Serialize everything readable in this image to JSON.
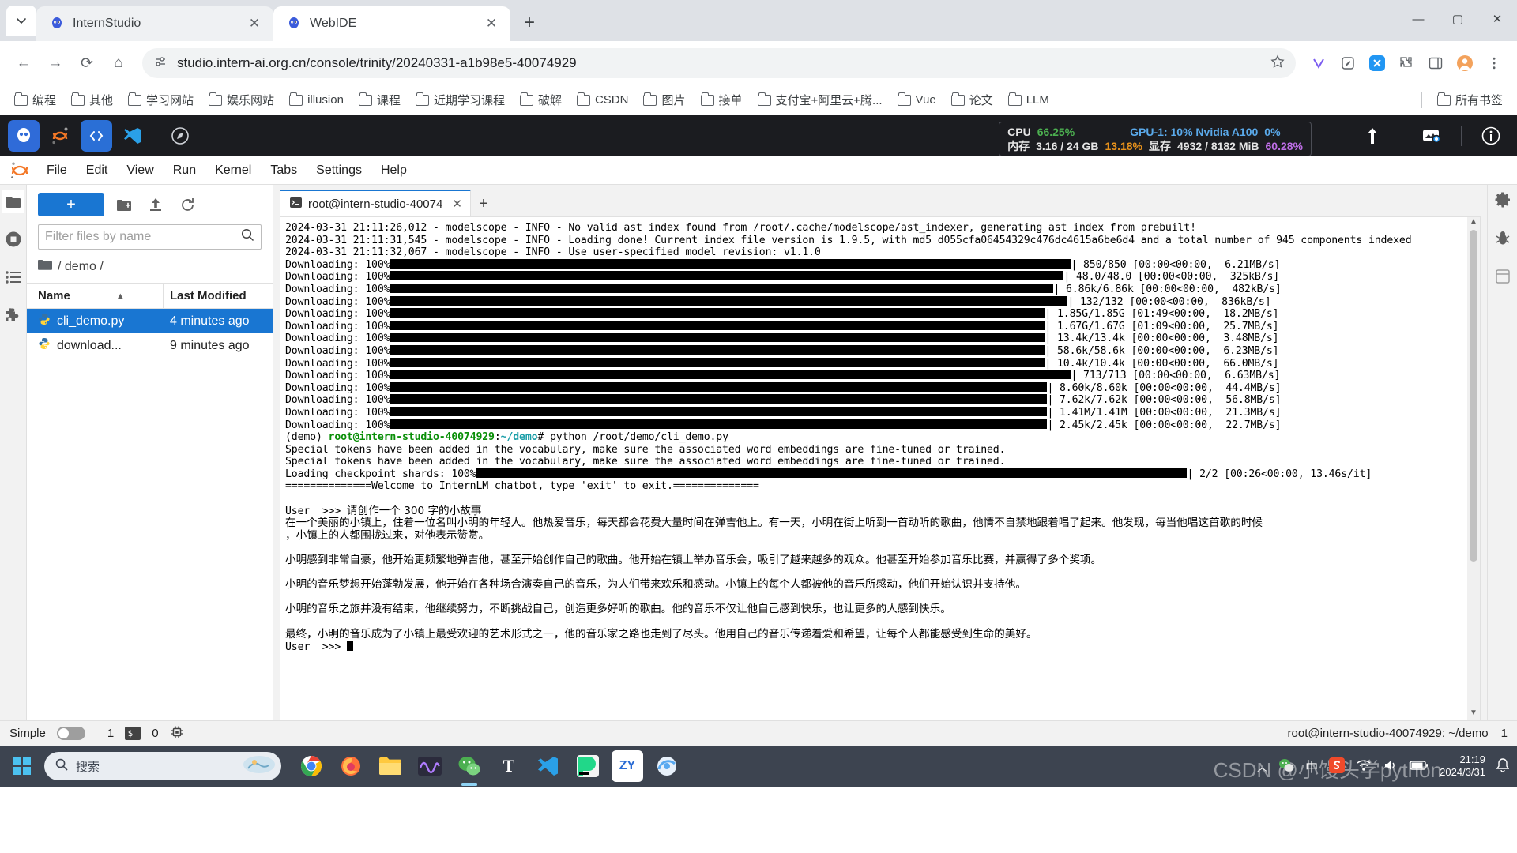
{
  "browser": {
    "tabs": [
      {
        "title": "InternStudio",
        "active": false
      },
      {
        "title": "WebIDE",
        "active": true
      }
    ],
    "new_tab_label": "+",
    "close_glyph": "✕",
    "window_controls": {
      "minimize": "—",
      "maximize": "▢",
      "close": "✕"
    },
    "nav": {
      "back": "←",
      "forward": "→",
      "reload": "⟳",
      "home": "⌂"
    },
    "url": "studio.intern-ai.org.cn/console/trinity/20240331-a1b98e5-40074929",
    "toolbar_icons": [
      "star-icon",
      "v-icon",
      "edit-icon",
      "x-extension-icon",
      "extensions-icon",
      "sidepanel-icon",
      "profile-icon",
      "menu-icon"
    ],
    "bookmarks": [
      {
        "label": "编程"
      },
      {
        "label": "其他"
      },
      {
        "label": "学习网站"
      },
      {
        "label": "娱乐网站"
      },
      {
        "label": "illusion"
      },
      {
        "label": "课程"
      },
      {
        "label": "近期学习课程"
      },
      {
        "label": "破解"
      },
      {
        "label": "CSDN"
      },
      {
        "label": "图片"
      },
      {
        "label": "接单"
      },
      {
        "label": "支付宝+阿里云+腾..."
      },
      {
        "label": "Vue"
      },
      {
        "label": "论文"
      },
      {
        "label": "LLM"
      }
    ],
    "bookmarks_all": "所有书签"
  },
  "jupyter_topbar": {
    "resource_monitor": {
      "cpu_label": "CPU",
      "cpu_value": "66.25%",
      "mem_label": "内存",
      "mem_value": "3.16 / 24 GB",
      "mem_pct": "13.18%",
      "gpu_label": "GPU-1: 10% Nvidia A100",
      "gpu_value": "0%",
      "vram_label": "显存",
      "vram_value": "4932 / 8182 MiB",
      "vram_pct": "60.28%"
    },
    "right_icons": [
      "upload-arrow-icon",
      "image-icon",
      "info-icon"
    ]
  },
  "jupyter_menu": {
    "items": [
      "File",
      "Edit",
      "View",
      "Run",
      "Kernel",
      "Tabs",
      "Settings",
      "Help"
    ]
  },
  "file_browser": {
    "new_button_label": "+",
    "toolbar_icons": [
      "new-folder-icon",
      "upload-icon",
      "refresh-icon"
    ],
    "filter_placeholder": "Filter files by name",
    "filter_value": "",
    "breadcrumb": "/ demo /",
    "columns": [
      "Name",
      "Last Modified"
    ],
    "sort_glyph": "▲",
    "files": [
      {
        "name": "cli_demo.py",
        "modified": "4 minutes ago",
        "selected": true,
        "icon": "python-file-icon"
      },
      {
        "name": "download...",
        "modified": "9 minutes ago",
        "selected": false,
        "icon": "python-file-icon"
      }
    ]
  },
  "left_sidebar_icons": [
    "folder-icon",
    "running-icon",
    "commands-icon",
    "extensions-icon"
  ],
  "right_rail_icons": [
    "settings-gear-icon",
    "debug-icon",
    "property-icon"
  ],
  "terminal": {
    "tab_title": "root@intern-studio-40074",
    "tab_close": "✕",
    "add_tab": "+",
    "log_lines": [
      "2024-03-31 21:11:26,012 - modelscope - INFO - No valid ast index found from /root/.cache/modelscope/ast_indexer, generating ast index from prebuilt!",
      "2024-03-31 21:11:31,545 - modelscope - INFO - Loading done! Current index file version is 1.9.5, with md5 d055cfa06454329c476dc4615a6be6d4 and a total number of 945 components indexed",
      "2024-03-31 21:11:32,067 - modelscope - INFO - Use user-specified model revision: v1.1.0"
    ],
    "download_label": "Downloading: 100%",
    "downloads": [
      {
        "size": "850/850",
        "stats": "[00:00<00:00,  6.21MB/s]",
        "barpx": 862
      },
      {
        "size": "48.0/48.0",
        "stats": "[00:00<00:00,  325kB/s]",
        "barpx": 853
      },
      {
        "size": "6.86k/6.86k",
        "stats": "[00:00<00:00,  482kB/s]",
        "barpx": 840
      },
      {
        "size": "132/132",
        "stats": "[00:00<00:00,  836kB/s]",
        "barpx": 858
      },
      {
        "size": "1.85G/1.85G",
        "stats": "[01:49<00:00,  18.2MB/s]",
        "barpx": 829
      },
      {
        "size": "1.67G/1.67G",
        "stats": "[01:09<00:00,  25.7MB/s]",
        "barpx": 829
      },
      {
        "size": "13.4k/13.4k",
        "stats": "[00:00<00:00,  3.48MB/s]",
        "barpx": 829
      },
      {
        "size": "58.6k/58.6k",
        "stats": "[00:00<00:00,  6.23MB/s]",
        "barpx": 829
      },
      {
        "size": "10.4k/10.4k",
        "stats": "[00:00<00:00,  66.0MB/s]",
        "barpx": 829
      },
      {
        "size": "713/713",
        "stats": "[00:00<00:00,  6.63MB/s]",
        "barpx": 862
      },
      {
        "size": "8.60k/8.60k",
        "stats": "[00:00<00:00,  44.4MB/s]",
        "barpx": 832
      },
      {
        "size": "7.62k/7.62k",
        "stats": "[00:00<00:00,  56.8MB/s]",
        "barpx": 832
      },
      {
        "size": "1.41M/1.41M",
        "stats": "[00:00<00:00,  21.3MB/s]",
        "barpx": 832
      },
      {
        "size": "2.45k/2.45k",
        "stats": "[00:00<00:00,  22.7MB/s]",
        "barpx": 832
      }
    ],
    "prompt_env": "(demo) ",
    "prompt_user": "root@intern-studio-40074929",
    "prompt_colon": ":",
    "prompt_path": "~/demo",
    "prompt_hash": "# ",
    "command": "python /root/demo/cli_demo.py",
    "warn_line": "Special tokens have been added in the vocabulary, make sure the associated word embeddings are fine-tuned or trained.",
    "shards_label": "Loading checkpoint shards: 100%",
    "shards_stats": "2/2 [00:26<00:00, 13.46s/it]",
    "welcome": "==============Welcome to InternLM chatbot, type 'exit' to exit.==============",
    "user_prefix": "User  >>> ",
    "user_input": "请创作一个 300 字的小故事",
    "story": [
      "在一个美丽的小镇上，住着一位名叫小明的年轻人。他热爱音乐，每天都会花费大量时间在弹吉他上。有一天，小明在街上听到一首动听的歌曲，他情不自禁地跟着唱了起来。他发现，每当他唱这首歌的时候",
      "，小镇上的人都围拢过来，对他表示赞赏。",
      "",
      "小明感到非常自豪，他开始更频繁地弹吉他，甚至开始创作自己的歌曲。他开始在镇上举办音乐会，吸引了越来越多的观众。他甚至开始参加音乐比赛，并赢得了多个奖项。",
      "",
      "小明的音乐梦想开始蓬勃发展，他开始在各种场合演奏自己的音乐，为人们带来欢乐和感动。小镇上的每个人都被他的音乐所感动，他们开始认识并支持他。",
      "",
      "小明的音乐之旅并没有结束，他继续努力，不断挑战自己，创造更多好听的歌曲。他的音乐不仅让他自己感到快乐，也让更多的人感到快乐。",
      "",
      "最终，小明的音乐成为了小镇上最受欢迎的艺术形式之一，他的音乐家之路也走到了尽头。他用自己的音乐传递着爱和希望，让每个人都能感受到生命的美好。"
    ],
    "final_prompt": "User  >>> "
  },
  "status_bar": {
    "simple_label": "Simple",
    "toggle_state": "off",
    "tab_count": "1",
    "terminal_icon_label": "$_",
    "kernel_count": "0",
    "session_text": "root@intern-studio-40074929: ~/demo",
    "right_count": "1"
  },
  "taskbar": {
    "search_placeholder": "搜索",
    "apps": [
      {
        "name": "chrome",
        "glyph": "◉",
        "color": "#4285f4"
      },
      {
        "name": "firefox",
        "glyph": "◉",
        "color": "#ff7139"
      },
      {
        "name": "file-explorer",
        "glyph": "▤",
        "color": "#ffc93e"
      },
      {
        "name": "editor",
        "glyph": "〰",
        "color": "#7c4dff"
      },
      {
        "name": "wechat",
        "glyph": "◍",
        "color": "#4caf50"
      },
      {
        "name": "typora",
        "glyph": "T",
        "color": "#ffffff"
      },
      {
        "name": "vscode",
        "glyph": "◣",
        "color": "#2aa0e8"
      },
      {
        "name": "pycharm",
        "glyph": "PC",
        "color": "#f0f0f0"
      },
      {
        "name": "zy-app",
        "glyph": "ZY",
        "color": "#ffffff"
      },
      {
        "name": "browser-2",
        "glyph": "◒",
        "color": "#59a9f0"
      }
    ],
    "tray": {
      "chevron": "︿",
      "wechat": "◍",
      "ime": "中",
      "sogou": "S",
      "wifi": "◗",
      "volume": "◁",
      "battery": "▮"
    },
    "clock_time": "21:19",
    "clock_date": "2024/3/31",
    "notify": "◻",
    "watermark": "CSDN @小馒头学python"
  }
}
